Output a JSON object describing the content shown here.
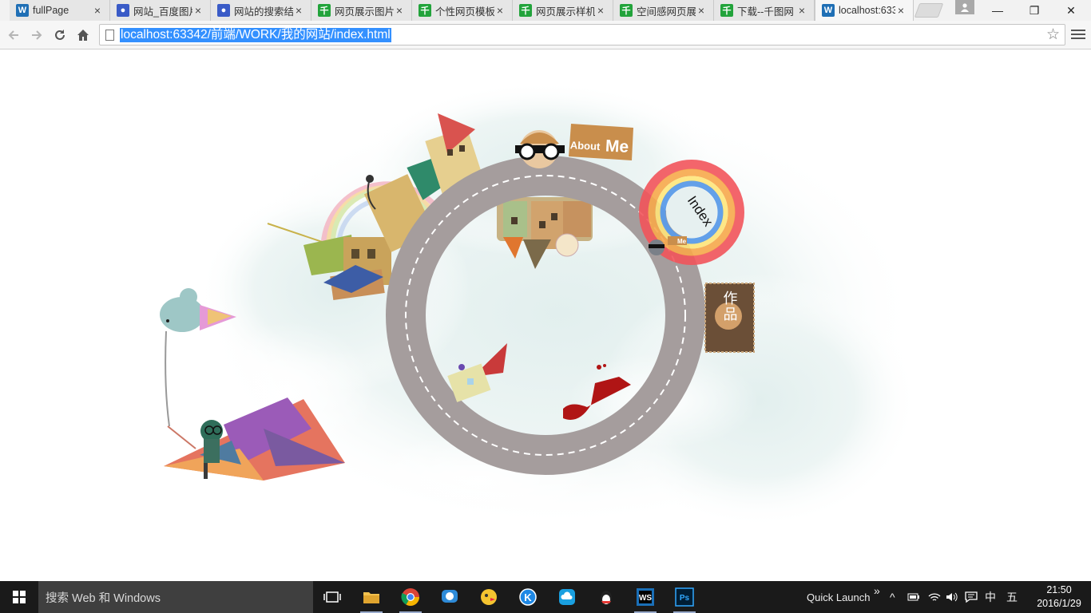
{
  "browser": {
    "tabs": [
      {
        "title": "fullPage",
        "favicon": "webstorm-icon"
      },
      {
        "title": "网站_百度图片",
        "favicon": "baidu-paw-icon"
      },
      {
        "title": "网站的搜索结果",
        "favicon": "baidu-paw-icon"
      },
      {
        "title": "网页展示图片",
        "favicon": "qiantu-icon"
      },
      {
        "title": "个性网页模板",
        "favicon": "qiantu-icon"
      },
      {
        "title": "网页展示样机",
        "favicon": "qiantu-icon"
      },
      {
        "title": "空间感网页展",
        "favicon": "qiantu-icon"
      },
      {
        "title": "下载--千图网",
        "favicon": "qiantu-icon"
      },
      {
        "title": "localhost:633",
        "favicon": "webstorm-icon"
      }
    ],
    "qiantu_glyph": "千",
    "address": "localhost:63342/前端/WORK/我的网站/index.html",
    "window_controls": {
      "minimize": "—",
      "maximize": "❐",
      "close": "✕"
    }
  },
  "page": {
    "about_sign_text": "About",
    "about_sign_me": "Me",
    "index_label": "Index",
    "works_label": "作品",
    "mini_sign_text": "Me"
  },
  "taskbar": {
    "search_placeholder": "搜索 Web 和 Windows",
    "quick_launch": "Quick Launch",
    "quick_launch_chevron": "»",
    "ime": "中",
    "ime_mode": "五",
    "time": "21:50",
    "date": "2016/1/29"
  },
  "colors": {
    "road": "#a59d9d",
    "sign_orange": "#c98e4c",
    "works_sign": "#6b4f37",
    "accent_url_highlight": "#3390ff"
  }
}
